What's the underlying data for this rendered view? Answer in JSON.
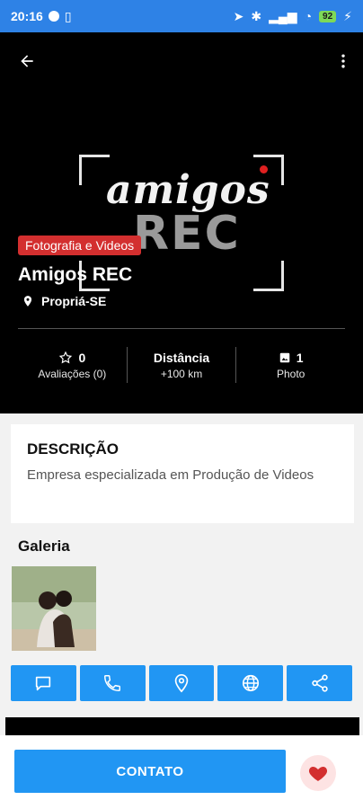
{
  "status_bar": {
    "time": "20:16",
    "battery": "92"
  },
  "place": {
    "category": "Fotografia e Videos",
    "name": "Amigos REC",
    "location": "Propriá-SE",
    "logo_line1": "amigos",
    "logo_line2": "REC"
  },
  "stats": {
    "rating_value": "0",
    "rating_label": "Avaliações (0)",
    "distance_title": "Distância",
    "distance_value": "+100 km",
    "photos_value": "1",
    "photos_label": "Photo"
  },
  "description": {
    "title": "DESCRIÇÃO",
    "text": "Empresa especializada em Produção de Videos"
  },
  "gallery": {
    "title": "Galeria"
  },
  "actions": [
    {
      "icon": "chat-icon"
    },
    {
      "icon": "phone-icon"
    },
    {
      "icon": "map-pin-icon"
    },
    {
      "icon": "globe-icon"
    },
    {
      "icon": "share-icon"
    }
  ],
  "bottom": {
    "contact_label": "CONTATO"
  },
  "colors": {
    "primary": "#2196f3",
    "status_bar": "#2e82e6",
    "badge": "#d32f2f",
    "favorite": "#d32f2f"
  }
}
